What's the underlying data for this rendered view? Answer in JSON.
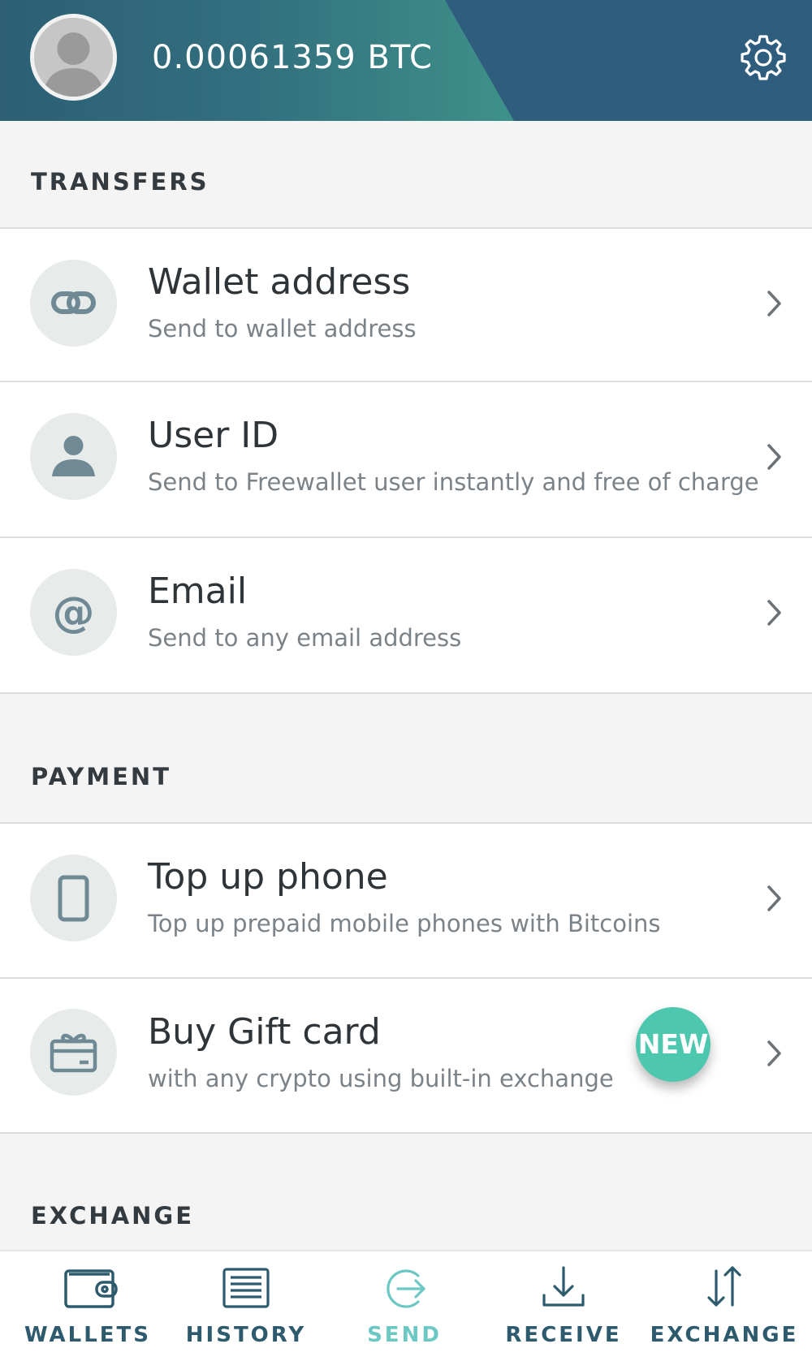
{
  "header": {
    "balance": "0.00061359 BTC",
    "avatar_icon": "user-avatar-icon",
    "settings_icon": "gear-icon",
    "colors": {
      "dark": "#2f5d7e",
      "teal": "#3c8c8a"
    }
  },
  "sections": {
    "transfers": "TRANSFERS",
    "payment": "PAYMENT",
    "exchange": "EXCHANGE"
  },
  "transfers": [
    {
      "icon": "link-icon",
      "title": "Wallet address",
      "subtitle": "Send to wallet address"
    },
    {
      "icon": "user-icon",
      "title": "User ID",
      "subtitle": "Send to Freewallet user instantly and free of charge"
    },
    {
      "icon": "at-sign-icon",
      "title": "Email",
      "subtitle": "Send to any email address"
    }
  ],
  "payment": [
    {
      "icon": "phone-icon",
      "title": "Top up phone",
      "subtitle": "Top up prepaid mobile phones with Bitcoins"
    },
    {
      "icon": "gift-card-icon",
      "title": "Buy Gift card",
      "subtitle": "with any crypto using built-in exchange",
      "badge": "NEW"
    }
  ],
  "tabbar": {
    "active_color": "#6cc8c2",
    "inactive_color": "#2e5a6e",
    "items": [
      {
        "icon": "wallet-icon",
        "label": "WALLETS"
      },
      {
        "icon": "history-list-icon",
        "label": "HISTORY"
      },
      {
        "icon": "send-arrow-icon",
        "label": "SEND",
        "active": true
      },
      {
        "icon": "download-icon",
        "label": "RECEIVE"
      },
      {
        "icon": "exchange-arrows-icon",
        "label": "EXCHANGE"
      }
    ]
  }
}
